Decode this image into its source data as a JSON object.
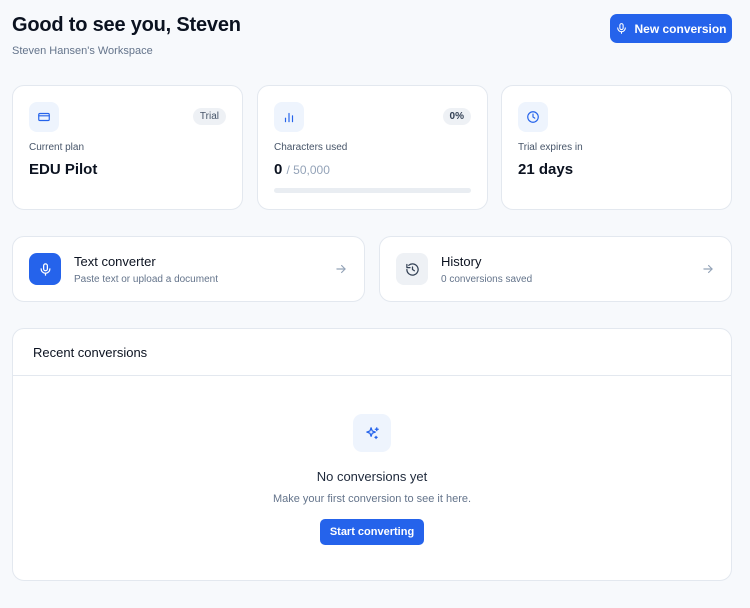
{
  "header": {
    "greeting": "Good to see you, Steven",
    "workspace": "Steven Hansen's Workspace",
    "new_conversion_label": "New conversion"
  },
  "stats": {
    "plan": {
      "label": "Current plan",
      "value": "EDU Pilot",
      "badge": "Trial",
      "icon": "credit-card-icon"
    },
    "characters": {
      "label": "Characters used",
      "value": "0",
      "total": "/ 50,000",
      "badge": "0%",
      "progress": 0,
      "icon": "bar-chart-icon"
    },
    "trial": {
      "label": "Trial expires in",
      "value": "21 days",
      "icon": "clock-icon"
    }
  },
  "actions": [
    {
      "title": "Text converter",
      "subtitle": "Paste text or upload a document",
      "icon": "microphone-icon"
    },
    {
      "title": "History",
      "subtitle": "0 conversions saved",
      "icon": "history-icon"
    }
  ],
  "recent": {
    "title": "Recent conversions",
    "empty_title": "No conversions yet",
    "empty_subtitle": "Make your first conversion to see it here.",
    "cta_label": "Start converting",
    "icon": "sparkles-icon"
  },
  "colors": {
    "accent": "#2563eb",
    "background": "#f7f9fc",
    "icon_bg": "#eef4fd"
  }
}
